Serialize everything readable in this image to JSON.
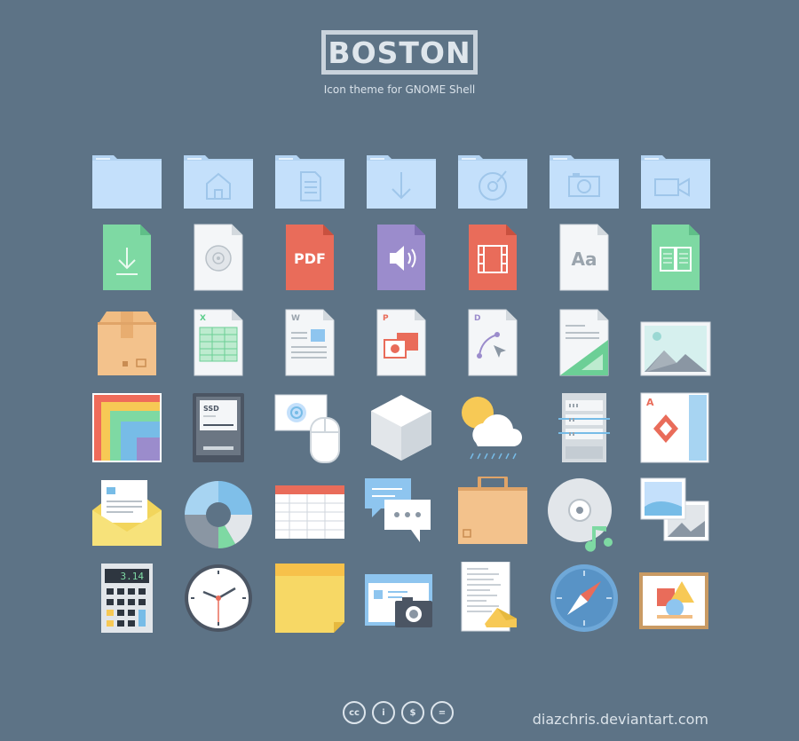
{
  "header": {
    "title": "BOSTON",
    "subtitle": "Icon theme for GNOME Shell"
  },
  "icons": [
    "folder-icon",
    "folder-home-icon",
    "folder-documents-icon",
    "folder-downloads-icon",
    "folder-music-icon",
    "folder-pictures-icon",
    "folder-videos-icon",
    "download-file-icon",
    "disc-image-file-icon",
    "pdf-file-icon",
    "audio-file-icon",
    "video-file-icon",
    "font-file-icon",
    "ebook-file-icon",
    "package-icon",
    "spreadsheet-file-icon",
    "text-document-file-icon",
    "presentation-file-icon",
    "drawing-file-icon",
    "template-file-icon",
    "image-file-icon",
    "color-palette-icon",
    "ssd-drive-icon",
    "input-mouse-icon",
    "3d-cube-icon",
    "weather-icon",
    "server-icon",
    "card-game-icon",
    "mail-icon",
    "pie-chart-icon",
    "spreadsheet-app-icon",
    "chat-icon",
    "briefcase-icon",
    "music-disc-icon",
    "image-viewer-icon",
    "calculator-icon",
    "clock-icon",
    "sticky-note-icon",
    "screenshot-icon",
    "text-editor-icon",
    "compass-browser-icon",
    "picture-frame-icon"
  ],
  "badges": {
    "pdf": "PDF",
    "font": "Aa",
    "ssd": "SSD",
    "calc": "3.14",
    "xls": "X",
    "doc": "W",
    "ppt": "P",
    "draw": "D",
    "card": "A"
  },
  "footer": {
    "license": [
      "cc",
      "by",
      "nc",
      "nd"
    ],
    "license_symbols": [
      "cc",
      "i",
      "$",
      "="
    ],
    "credit": "diazchris.deviantart.com"
  },
  "colors": {
    "background": "#5d7386",
    "folder": "#c4e0fb",
    "green": "#7ed9a3",
    "red": "#e96c5a",
    "purple": "#9b8ccc"
  }
}
